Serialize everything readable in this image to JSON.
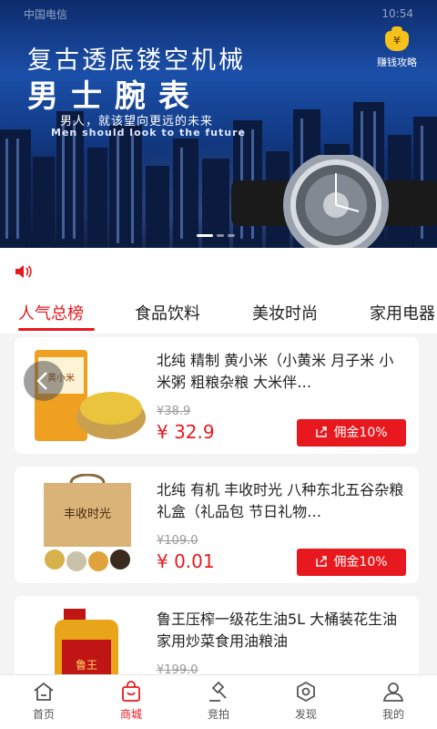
{
  "status_bar": {
    "left": "中国电信",
    "right": "10:54"
  },
  "banner": {
    "line1": "复古透底镂空机械",
    "line2": "男士腕表",
    "line3": "男人，就该望向更远的未来",
    "line4": "Men should look to the future",
    "tips_label": "赚钱攻略",
    "tips_icon": "money-bag-icon",
    "slide_count": 3,
    "active_slide": 1
  },
  "notice": {
    "icon": "speaker-icon"
  },
  "tabs": [
    {
      "label": "人气总榜",
      "active": true
    },
    {
      "label": "食品饮料",
      "active": false
    },
    {
      "label": "美妆时尚",
      "active": false
    },
    {
      "label": "家用电器",
      "active": false
    }
  ],
  "products": [
    {
      "title": "北纯 精制 黄小米（小黄米 月子米 小米粥 粗粮杂粮 大米伴…",
      "original_price": "¥38.9",
      "price": "¥ 32.9",
      "commission": "佣金10%"
    },
    {
      "title": "北纯 有机 丰收时光 八种东北五谷杂粮礼盒（礼品包 节日礼物…",
      "original_price": "¥109.0",
      "price": "¥ 0.01",
      "commission": "佣金10%"
    },
    {
      "title": "鲁王压榨一级花生油5L 大桶装花生油家用炒菜食用油粮油",
      "original_price": "¥199.0",
      "price": "",
      "commission": ""
    }
  ],
  "nav": [
    {
      "label": "首页",
      "icon": "home-icon",
      "active": false
    },
    {
      "label": "商城",
      "icon": "shopping-bag-icon",
      "active": true
    },
    {
      "label": "竞拍",
      "icon": "gavel-icon",
      "active": false
    },
    {
      "label": "发现",
      "icon": "compass-icon",
      "active": false
    },
    {
      "label": "我的",
      "icon": "user-icon",
      "active": false
    }
  ],
  "colors": {
    "accent": "#e8191e",
    "banner_dark": "#0a1e4d"
  }
}
